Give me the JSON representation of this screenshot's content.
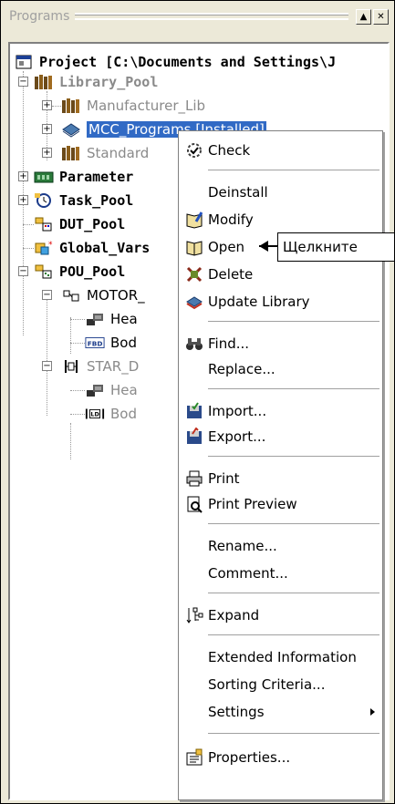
{
  "panel": {
    "title": "Programs",
    "buttons": {
      "minimize": "▲",
      "close": "✕"
    }
  },
  "tree": {
    "root": "Project [C:\\Documents and Settings\\J",
    "library_pool": "Library_Pool",
    "manufacturer_lib": "Manufacturer_Lib",
    "mcc_programs": "MCC_Programs [Installed]",
    "standard": "Standard",
    "parameter": "Parameter",
    "task_pool": "Task_Pool",
    "dut_pool": "DUT_Pool",
    "global_vars": "Global_Vars",
    "pou_pool": "POU_Pool",
    "motor": "MOTOR_",
    "motor_header": "Hea",
    "motor_fbd_tag": "FBD",
    "motor_body": "Bod",
    "star": "STAR_D",
    "star_header": "Hea",
    "star_ld_tag": "LD",
    "star_body": "Bod"
  },
  "menu": {
    "check": "Check",
    "deinstall": "Deinstall",
    "modify": "Modify",
    "open": "Open",
    "delete": "Delete",
    "update_library": "Update Library",
    "find": "Find...",
    "replace": "Replace...",
    "import": "Import...",
    "export": "Export...",
    "print": "Print",
    "print_preview": "Print Preview",
    "rename": "Rename...",
    "comment": "Comment...",
    "expand": "Expand",
    "extended_information": "Extended Information",
    "sorting_criteria": "Sorting Criteria...",
    "settings": "Settings",
    "properties": "Properties..."
  },
  "callout": {
    "text": "Щелкните"
  },
  "colors": {
    "selection": "#316ac5",
    "panel_bg": "#ece9d8",
    "tree_gray": "#8a8a8a"
  }
}
